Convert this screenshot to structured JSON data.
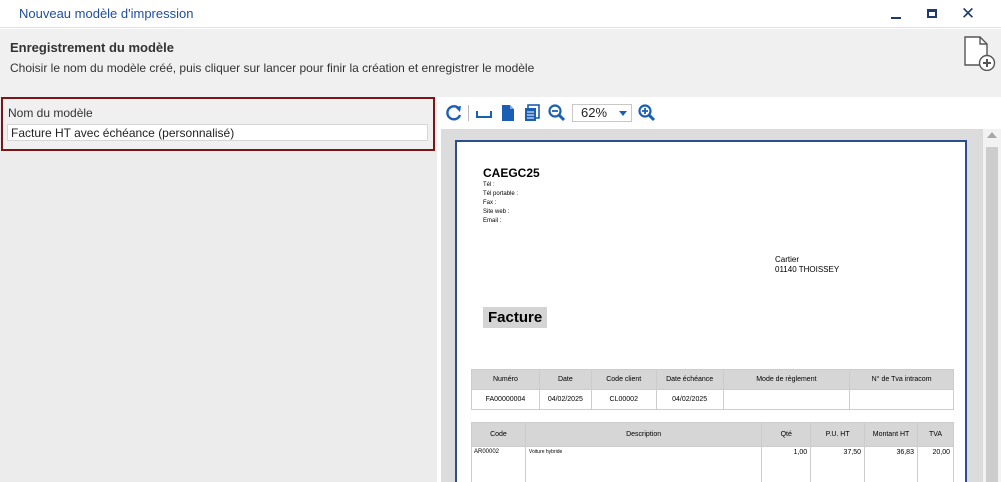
{
  "window": {
    "title": "Nouveau modèle d'impression",
    "minimize_label": "minimize",
    "maximize_label": "maximize",
    "close_glyph": "✕"
  },
  "header": {
    "title": "Enregistrement du modèle",
    "subtitle": "Choisir le nom du modèle créé, puis cliquer sur lancer pour finir la création et enregistrer le modèle",
    "icon": "document-add-icon"
  },
  "form": {
    "label": "Nom du modèle",
    "value": "Facture HT avec échéance (personnalisé)"
  },
  "toolbar": {
    "icons": [
      "refresh-icon",
      "page-width-icon",
      "single-page-icon",
      "multi-page-icon",
      "zoom-out-icon",
      "zoom-in-icon"
    ],
    "zoom": "62%"
  },
  "preview": {
    "company": "CAEGC25",
    "contact_lines": [
      "Tél :",
      "Tél portable :",
      "Fax :",
      "Site web :",
      "Email :"
    ],
    "recipient_lines": [
      "Cartier",
      "01140 THOISSEY"
    ],
    "doc_title": "Facture",
    "info_table": {
      "headers": [
        "Numéro",
        "Date",
        "Code client",
        "Date échéance",
        "Mode de règlement",
        "N° de Tva intracom"
      ],
      "row": [
        "FA00000004",
        "04/02/2025",
        "CL00002",
        "04/02/2025",
        "",
        ""
      ]
    },
    "lines_table": {
      "headers": [
        "Code",
        "Description",
        "Qté",
        "P.U. HT",
        "Montant HT",
        "TVA"
      ],
      "row": [
        "AR00002",
        "Voiture hybride",
        "1,00",
        "37,50",
        "36,83",
        "20,00"
      ]
    }
  },
  "colors": {
    "title_blue": "#1f4e9c",
    "highlight_border": "#7a1518",
    "icon_blue": "#1b5fb5",
    "page_border": "#2c4d8f"
  }
}
